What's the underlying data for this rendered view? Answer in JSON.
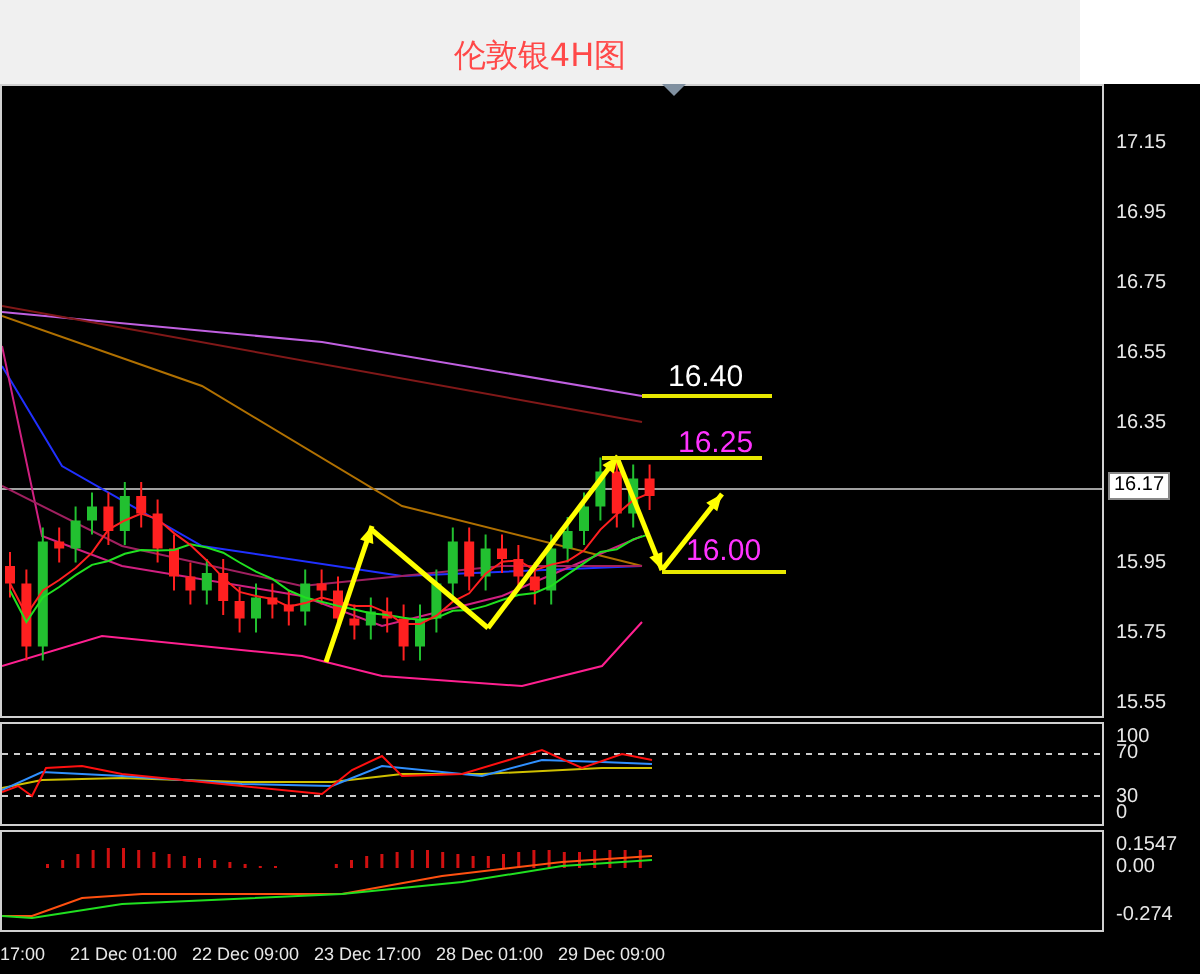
{
  "title": "伦敦银4H图",
  "price_chart": {
    "axis_labels": [
      "17.15",
      "16.95",
      "16.75",
      "16.55",
      "16.35",
      "15.95",
      "15.75",
      "15.55"
    ],
    "current_price": "16.17",
    "annotations": [
      {
        "label": "16.40",
        "color": "#ffffff"
      },
      {
        "label": "16.25",
        "color": "#ff33ff"
      },
      {
        "label": "16.00",
        "color": "#ff33ff"
      }
    ]
  },
  "oscillator": {
    "axis_labels": [
      "100",
      "70",
      "30",
      "0"
    ]
  },
  "macd": {
    "axis_labels": [
      "0.1547",
      "0.00",
      "-0.274"
    ]
  },
  "time_axis": [
    "17:00",
    "21 Dec 01:00",
    "22 Dec 09:00",
    "23 Dec 17:00",
    "28 Dec 01:00",
    "29 Dec 09:00"
  ]
}
